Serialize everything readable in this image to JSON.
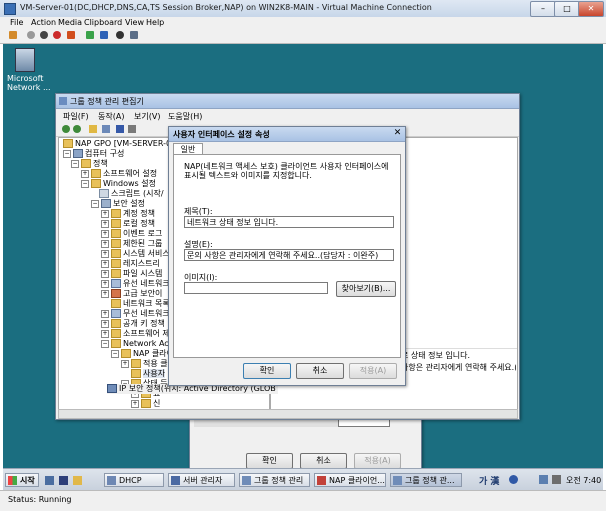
{
  "vm_window": {
    "title": "VM-Server-01(DC,DHCP,DNS,CA,TS Session Broker,NAP) on WIN2K8-MAIN - Virtual Machine Connection",
    "menu": [
      "File",
      "Action",
      "Media",
      "Clipboard",
      "View",
      "Help"
    ],
    "status": "Status: Running"
  },
  "desktop_icon": {
    "label_line1": "Microsoft",
    "label_line2": "Network ..."
  },
  "gpo_editor": {
    "title": "그룹 정책 관리 편집기",
    "menu": [
      "파일(F)",
      "동작(A)",
      "보기(V)",
      "도움말(H)"
    ],
    "tree": [
      "NAP GPO [VM-SERVER-01.C",
      "컴퓨터 구성",
      "정책",
      "소프트웨어 설정",
      "Windows 설정",
      "스크립트 (시작/",
      "보안 설정",
      "계정 정책",
      "로컬 정책",
      "이벤트 로그",
      "제한된 그룹",
      "시스템 서비스",
      "레지스트리",
      "파일 시스템",
      "유선 네트워크",
      "고급 보안이",
      "네트워크 목록",
      "무선 네트워크",
      "공개 키 정책",
      "소프트웨어 제",
      "Network Acc",
      "NAP 클라이",
      "적용 클",
      "사용자",
      "상태 등",
      "요",
      "신",
      "IP 보안 정책(위치: Active Directory (GLOB"
    ],
    "right_text_1": "로 상태 정보 입니다.",
    "right_text_2": "사항은 관리자에게 연락해 주세요.(5"
  },
  "dialog": {
    "title": "사용자 인터페이스 설정 속성",
    "tab": "일반",
    "description": "NAP(네트워크 액세스 보호) 클라이언트 사용자 인터페이스에 표시될 텍스트와 이미지를 지정합니다.",
    "title_label": "제목(T):",
    "title_value": "네트워크 상태 정보 입니다.",
    "desc_label": "설명(E):",
    "desc_value": "문의 사항은 관리자에게 연락해 주세요..(담당자 : 이완주)",
    "image_label": "이미지(I):",
    "image_value": "",
    "browse_button": "찾아보기(B)...",
    "ok": "확인",
    "cancel": "취소",
    "apply": "적용(A)"
  },
  "background_dialog": {
    "ok": "확인",
    "cancel": "취소",
    "apply": "적용(A)"
  },
  "taskbar": {
    "start": "시작",
    "tasks": [
      "DHCP",
      "서버 관리자",
      "그룹 정책 관리",
      "NAP 클라이언...",
      "그룹 정책 관..."
    ],
    "ime": "가 漢",
    "clock": "오전 7:40"
  }
}
